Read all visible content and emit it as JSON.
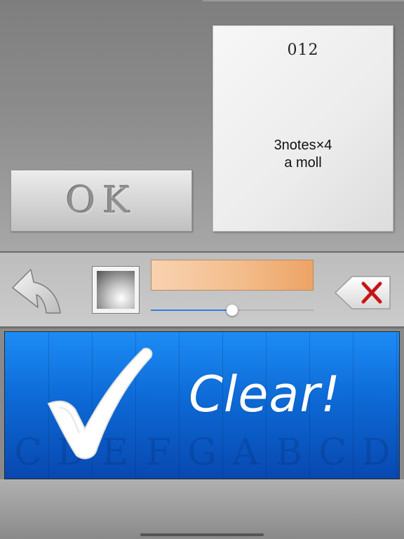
{
  "card": {
    "number": "012",
    "info_line1": "3notes×4",
    "info_line2": "a moll"
  },
  "ok_button": {
    "label": "OK"
  },
  "toolbar": {
    "undo_icon": "undo-arrow-icon",
    "sound_icon": "sound-swatch-icon",
    "color_bar_color": "#f3bd8c",
    "slider_value": 0.5,
    "delete_icon": "delete-backspace-icon"
  },
  "clear_panel": {
    "message": "Clear!",
    "check_icon": "check-mark-icon",
    "note_letters": [
      "C",
      "D",
      "E",
      "F",
      "G",
      "A",
      "B",
      "C",
      "D"
    ],
    "accent_color": "#1d8cf5"
  }
}
